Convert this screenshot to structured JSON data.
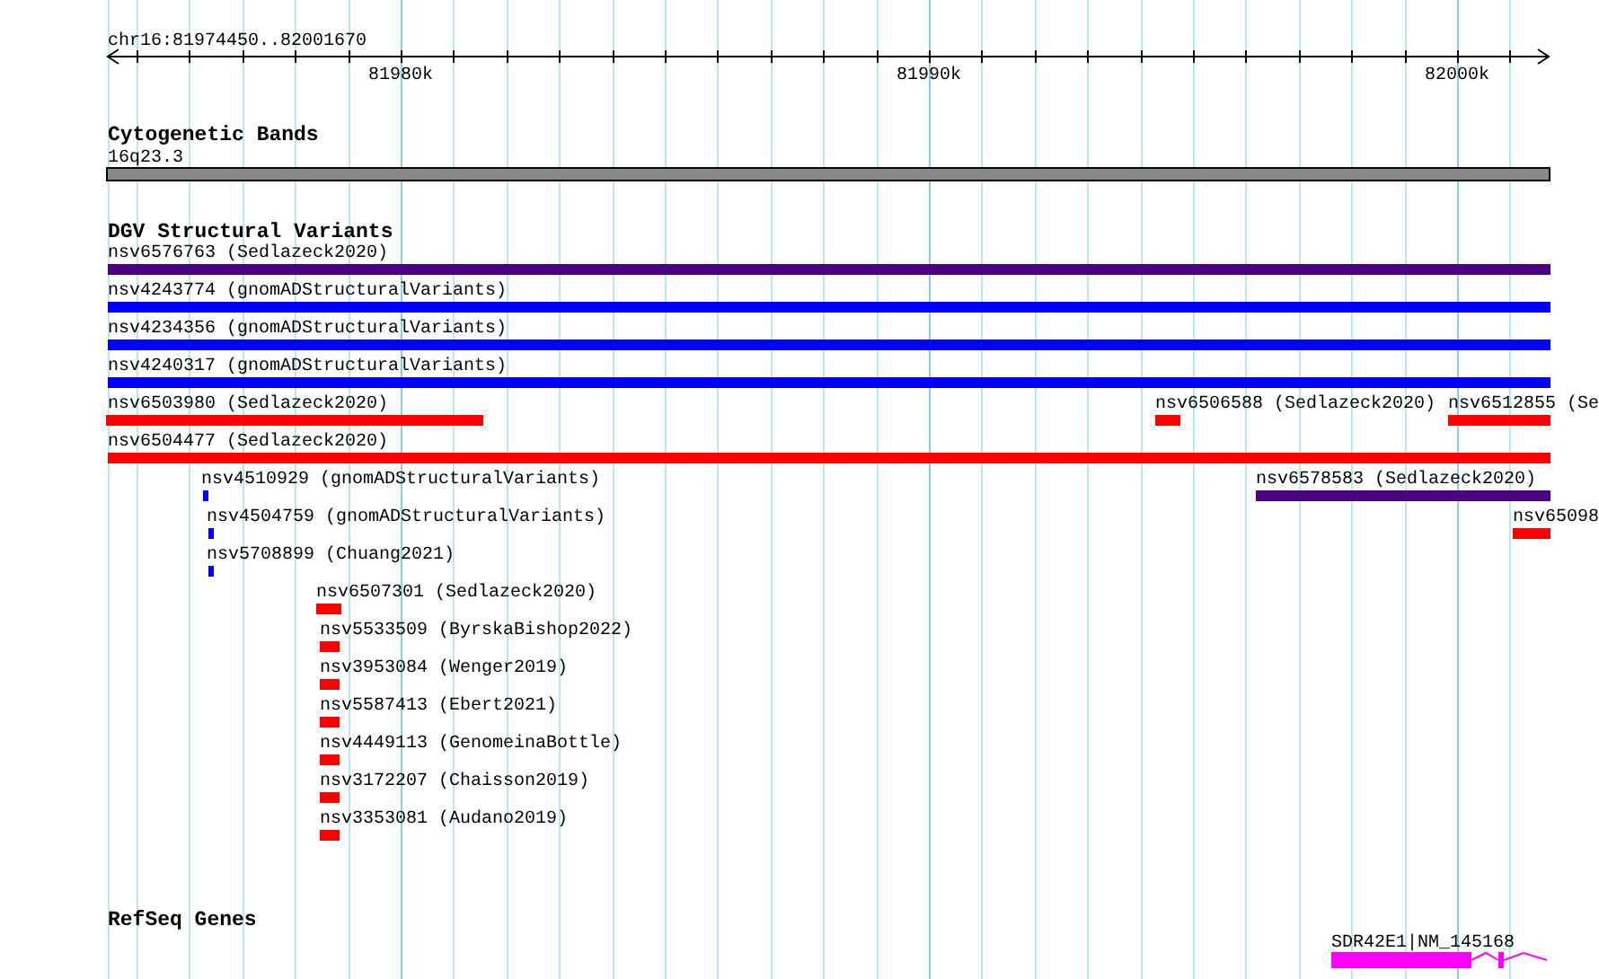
{
  "ruler": {
    "location": "chr16:81974450..82001670",
    "tick_labels": [
      "81980k",
      "81990k",
      "82000k"
    ]
  },
  "tracks": [
    {
      "title": "Cytogenetic Bands",
      "kind": "band",
      "features": [
        {
          "label": "16q23.3"
        }
      ]
    },
    {
      "title": "DGV Structural Variants",
      "kind": "variant",
      "features": [
        {
          "label": "nsv6576763 (Sedlazeck2020)",
          "color": "#4b0082"
        },
        {
          "label": "nsv4243774 (gnomADStructuralVariants)",
          "color": "#0000ff"
        },
        {
          "label": "nsv4234356 (gnomADStructuralVariants)",
          "color": "#0000ff"
        },
        {
          "label": "nsv4240317 (gnomADStructuralVariants)",
          "color": "#0000ff"
        },
        {
          "label": "nsv6503980 (Sedlazeck2020)",
          "color": "#ff0000"
        },
        {
          "label": "nsv6506588 (Sedlazeck2020)",
          "color": "#ff0000"
        },
        {
          "label": "nsv6512855 (Se",
          "color": "#ff0000"
        },
        {
          "label": "nsv6504477 (Sedlazeck2020)",
          "color": "#ff0000"
        },
        {
          "label": "nsv4510929 (gnomADStructuralVariants)",
          "color": "#0000ff"
        },
        {
          "label": "nsv6578583 (Sedlazeck2020)",
          "color": "#4b0082"
        },
        {
          "label": "nsv4504759 (gnomADStructuralVariants)",
          "color": "#0000ff"
        },
        {
          "label": "nsv65098",
          "color": "#ff0000"
        },
        {
          "label": "nsv5708899 (Chuang2021)",
          "color": "#0000ff"
        },
        {
          "label": "nsv6507301 (Sedlazeck2020)",
          "color": "#ff0000"
        },
        {
          "label": "nsv5533509 (ByrskaBishop2022)",
          "color": "#ff0000"
        },
        {
          "label": "nsv3953084 (Wenger2019)",
          "color": "#ff0000"
        },
        {
          "label": "nsv5587413 (Ebert2021)",
          "color": "#ff0000"
        },
        {
          "label": "nsv4449113 (GenomeinaBottle)",
          "color": "#ff0000"
        },
        {
          "label": "nsv3172207 (Chaisson2019)",
          "color": "#ff0000"
        },
        {
          "label": "nsv3353081 (Audano2019)",
          "color": "#ff0000"
        }
      ]
    },
    {
      "title": "RefSeq Genes",
      "kind": "gene",
      "features": [
        {
          "label": "SDR42E1|NM_145168",
          "color": "#ff00ff"
        }
      ]
    }
  ]
}
